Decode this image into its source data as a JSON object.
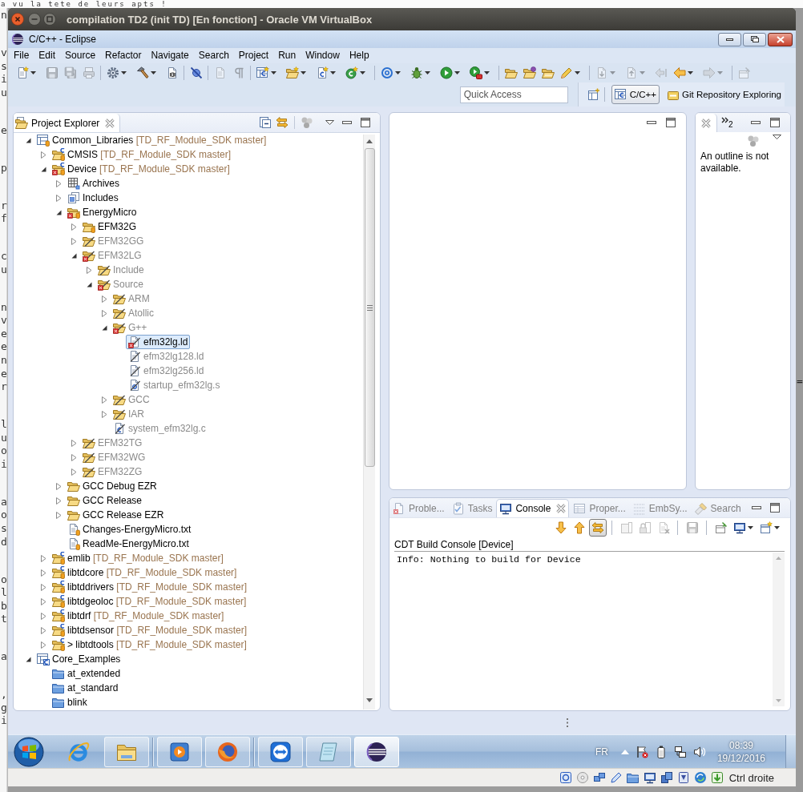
{
  "background": {
    "top_line": "a vu la tete de leurs apts !",
    "left_fragments": [
      "n",
      "v\ns\ni\nu",
      "e",
      "p",
      "r\nf",
      "c\nu",
      "n\nv\ne\ne\nn\ne\nr",
      "l\nu\no\ni",
      "a\no\ns\nd",
      "o\nl\nb\nt",
      "a",
      ",\ng\ni"
    ],
    "right_fragment": "="
  },
  "vm_window": {
    "title": "compilation TD2 (init TD) [En fonction] - Oracle VM VirtualBox",
    "status_bar": {
      "indicators": [
        {
          "kind": "harddisk"
        },
        {
          "kind": "optical"
        },
        {
          "kind": "network"
        },
        {
          "kind": "usb"
        },
        {
          "kind": "sharedfolder"
        },
        {
          "kind": "display"
        },
        {
          "kind": "capture"
        },
        {
          "kind": "vtx"
        },
        {
          "kind": "mouse"
        },
        {
          "kind": "keyboard"
        }
      ],
      "host_key": "Ctrl droite"
    }
  },
  "eclipse": {
    "title": "C/C++ - Eclipse",
    "menu": [
      "File",
      "Edit",
      "Source",
      "Refactor",
      "Navigate",
      "Search",
      "Project",
      "Run",
      "Window",
      "Help"
    ],
    "toolbar": {
      "groups": [
        {
          "items": [
            {
              "kind": "new",
              "disabled": false,
              "menu": true
            },
            {
              "kind": "save",
              "disabled": true,
              "menu": false
            },
            {
              "kind": "saveall",
              "disabled": true,
              "menu": false
            },
            {
              "kind": "print",
              "disabled": true,
              "menu": false
            }
          ]
        },
        {
          "items": [
            {
              "kind": "configs",
              "disabled": false,
              "menu": true
            },
            {
              "kind": "build",
              "disabled": false,
              "menu": true
            },
            {
              "kind": "binary",
              "disabled": false,
              "menu": false
            }
          ]
        },
        {
          "items": [
            {
              "kind": "skip",
              "disabled": false,
              "menu": false
            }
          ]
        },
        {
          "items": [
            {
              "kind": "marks",
              "disabled": true,
              "menu": false
            },
            {
              "kind": "whitespace",
              "disabled": true,
              "menu": false
            }
          ]
        },
        {
          "items": [
            {
              "kind": "newproject",
              "disabled": false,
              "menu": true
            },
            {
              "kind": "newfolder",
              "disabled": false,
              "menu": true
            },
            {
              "kind": "newfile",
              "disabled": false,
              "menu": true
            },
            {
              "kind": "newclass",
              "disabled": false,
              "menu": true
            }
          ]
        },
        {
          "items": [
            {
              "kind": "at",
              "disabled": false,
              "menu": true
            },
            {
              "kind": "debug",
              "disabled": false,
              "menu": true
            },
            {
              "kind": "run",
              "disabled": false,
              "menu": true
            },
            {
              "kind": "external",
              "disabled": false,
              "menu": true
            }
          ]
        },
        {
          "items": [
            {
              "kind": "open",
              "disabled": false,
              "menu": false
            },
            {
              "kind": "openball",
              "disabled": false,
              "menu": false
            },
            {
              "kind": "openfolder",
              "disabled": false,
              "menu": false
            },
            {
              "kind": "pencil",
              "disabled": false,
              "menu": true
            }
          ]
        },
        {
          "items": [
            {
              "kind": "nextannot",
              "disabled": true,
              "menu": true
            },
            {
              "kind": "prevannot",
              "disabled": true,
              "menu": true
            },
            {
              "kind": "lastedit",
              "disabled": true,
              "menu": false
            },
            {
              "kind": "back",
              "disabled": false,
              "menu": true
            },
            {
              "kind": "forward",
              "disabled": true,
              "menu": true
            }
          ]
        },
        {
          "items": [
            {
              "kind": "pin",
              "disabled": true,
              "menu": false
            }
          ]
        }
      ]
    },
    "quick_access": {
      "placeholder": "Quick Access"
    },
    "perspectives": [
      {
        "kind": "cpp",
        "label": "C/C++",
        "selected": true
      },
      {
        "kind": "git",
        "label": "Git Repository Exploring",
        "selected": false
      }
    ]
  },
  "project_explorer": {
    "tab": "Project Explorer",
    "tree": [
      {
        "kind": "workingset",
        "label": "Common_Libraries",
        "decoration": "[TD_RF_Module_SDK master]",
        "expanded": true,
        "selected": false,
        "excluded": false,
        "error": false,
        "tracked": true,
        "children": [
          {
            "kind": "cproject",
            "label": "CMSIS",
            "decoration": "[TD_RF_Module_SDK master]",
            "expanded": false,
            "selected": false,
            "excluded": false,
            "error": false,
            "tracked": true
          },
          {
            "kind": "cproject",
            "label": "Device",
            "decoration": "[TD_RF_Module_SDK master]",
            "expanded": true,
            "selected": false,
            "excluded": false,
            "error": true,
            "tracked": true,
            "children": [
              {
                "kind": "archives",
                "label": "Archives",
                "expanded": false,
                "selected": false,
                "excluded": false,
                "error": false,
                "tracked": false
              },
              {
                "kind": "includes",
                "label": "Includes",
                "expanded": false,
                "selected": false,
                "excluded": false,
                "error": false,
                "tracked": false
              },
              {
                "kind": "folder",
                "label": "EnergyMicro",
                "expanded": true,
                "selected": false,
                "excluded": false,
                "error": true,
                "tracked": true,
                "children": [
                  {
                    "kind": "folder",
                    "label": "EFM32G",
                    "expanded": false,
                    "selected": false,
                    "excluded": false,
                    "error": false,
                    "tracked": true
                  },
                  {
                    "kind": "folder",
                    "label": "EFM32GG",
                    "expanded": false,
                    "selected": false,
                    "excluded": true,
                    "error": false,
                    "tracked": false
                  },
                  {
                    "kind": "folder",
                    "label": "EFM32LG",
                    "expanded": true,
                    "selected": false,
                    "excluded": true,
                    "error": true,
                    "tracked": false,
                    "children": [
                      {
                        "kind": "folder",
                        "label": "Include",
                        "expanded": false,
                        "selected": false,
                        "excluded": true,
                        "error": false,
                        "tracked": false
                      },
                      {
                        "kind": "folder",
                        "label": "Source",
                        "expanded": true,
                        "selected": false,
                        "excluded": true,
                        "error": true,
                        "tracked": false,
                        "children": [
                          {
                            "kind": "folder",
                            "label": "ARM",
                            "expanded": false,
                            "selected": false,
                            "excluded": true,
                            "error": false,
                            "tracked": false
                          },
                          {
                            "kind": "folder",
                            "label": "Atollic",
                            "expanded": false,
                            "selected": false,
                            "excluded": true,
                            "error": false,
                            "tracked": false
                          },
                          {
                            "kind": "folder",
                            "label": "G++",
                            "expanded": true,
                            "selected": false,
                            "excluded": true,
                            "error": true,
                            "tracked": false,
                            "children": [
                              {
                                "kind": "file",
                                "label": "efm32lg.ld",
                                "selected": true,
                                "excluded": true,
                                "error": true,
                                "tracked": false
                              },
                              {
                                "kind": "file",
                                "label": "efm32lg128.ld",
                                "selected": false,
                                "excluded": true,
                                "error": false,
                                "tracked": false
                              },
                              {
                                "kind": "file",
                                "label": "efm32lg256.ld",
                                "selected": false,
                                "excluded": true,
                                "error": false,
                                "tracked": false
                              },
                              {
                                "kind": "asmfile",
                                "label": "startup_efm32lg.s",
                                "selected": false,
                                "excluded": true,
                                "error": false,
                                "tracked": false
                              }
                            ]
                          },
                          {
                            "kind": "folder",
                            "label": "GCC",
                            "expanded": false,
                            "selected": false,
                            "excluded": true,
                            "error": false,
                            "tracked": false
                          },
                          {
                            "kind": "folder",
                            "label": "IAR",
                            "expanded": false,
                            "selected": false,
                            "excluded": true,
                            "error": false,
                            "tracked": false
                          },
                          {
                            "kind": "cfile",
                            "label": "system_efm32lg.c",
                            "selected": false,
                            "excluded": true,
                            "error": false,
                            "tracked": false
                          }
                        ]
                      }
                    ]
                  },
                  {
                    "kind": "folder",
                    "label": "EFM32TG",
                    "expanded": false,
                    "selected": false,
                    "excluded": true,
                    "error": false,
                    "tracked": false
                  },
                  {
                    "kind": "folder",
                    "label": "EFM32WG",
                    "expanded": false,
                    "selected": false,
                    "excluded": true,
                    "error": false,
                    "tracked": false
                  },
                  {
                    "kind": "folder",
                    "label": "EFM32ZG",
                    "expanded": false,
                    "selected": false,
                    "excluded": true,
                    "error": false,
                    "tracked": false
                  }
                ]
              },
              {
                "kind": "folder",
                "label": "GCC Debug EZR",
                "expanded": false,
                "selected": false,
                "excluded": false,
                "error": false,
                "tracked": false
              },
              {
                "kind": "folder",
                "label": "GCC Release",
                "expanded": false,
                "selected": false,
                "excluded": false,
                "error": false,
                "tracked": false
              },
              {
                "kind": "folder",
                "label": "GCC Release EZR",
                "expanded": false,
                "selected": false,
                "excluded": false,
                "error": false,
                "tracked": false
              },
              {
                "kind": "textfile",
                "label": "Changes-EnergyMicro.txt",
                "selected": false,
                "excluded": false,
                "error": false,
                "tracked": true
              },
              {
                "kind": "textfile",
                "label": "ReadMe-EnergyMicro.txt",
                "selected": false,
                "excluded": false,
                "error": false,
                "tracked": true
              }
            ]
          },
          {
            "kind": "cproject",
            "label": "emlib",
            "decoration": "[TD_RF_Module_SDK master]",
            "expanded": false,
            "selected": false,
            "excluded": false,
            "error": false,
            "tracked": true
          },
          {
            "kind": "cproject",
            "label": "libtdcore",
            "decoration": "[TD_RF_Module_SDK master]",
            "expanded": false,
            "selected": false,
            "excluded": false,
            "error": false,
            "tracked": true
          },
          {
            "kind": "cproject",
            "label": "libtddrivers",
            "decoration": "[TD_RF_Module_SDK master]",
            "expanded": false,
            "selected": false,
            "excluded": false,
            "error": false,
            "tracked": true
          },
          {
            "kind": "cproject",
            "label": "libtdgeoloc",
            "decoration": "[TD_RF_Module_SDK master]",
            "expanded": false,
            "selected": false,
            "excluded": false,
            "error": false,
            "tracked": true
          },
          {
            "kind": "cproject",
            "label": "libtdrf",
            "decoration": "[TD_RF_Module_SDK master]",
            "expanded": false,
            "selected": false,
            "excluded": false,
            "error": false,
            "tracked": true
          },
          {
            "kind": "cproject",
            "label": "libtdsensor",
            "decoration": "[TD_RF_Module_SDK master]",
            "expanded": false,
            "selected": false,
            "excluded": false,
            "error": false,
            "tracked": true
          },
          {
            "kind": "cproject",
            "label": "> libtdtools",
            "decoration": "[TD_RF_Module_SDK master]",
            "expanded": false,
            "selected": false,
            "excluded": false,
            "error": false,
            "tracked": true
          }
        ]
      },
      {
        "kind": "cworkingset",
        "label": "Core_Examples",
        "expanded": true,
        "selected": false,
        "excluded": false,
        "error": false,
        "tracked": false,
        "children": [
          {
            "kind": "examplefolder",
            "label": "at_extended",
            "selected": false,
            "excluded": false,
            "error": false,
            "tracked": false
          },
          {
            "kind": "examplefolder",
            "label": "at_standard",
            "selected": false,
            "excluded": false,
            "error": false,
            "tracked": false
          },
          {
            "kind": "examplefolder",
            "label": "blink",
            "selected": false,
            "excluded": false,
            "error": false,
            "tracked": false
          }
        ]
      }
    ]
  },
  "outline": {
    "overflow_count": "2",
    "message": "An outline is not available."
  },
  "console": {
    "tabs": [
      {
        "kind": "problems",
        "label": "Proble...",
        "selected": false
      },
      {
        "kind": "tasks",
        "label": "Tasks",
        "selected": false
      },
      {
        "kind": "console",
        "label": "Console",
        "selected": true
      },
      {
        "kind": "properties",
        "label": "Proper...",
        "selected": false
      },
      {
        "kind": "registers",
        "label": "EmbSy...",
        "selected": false
      },
      {
        "kind": "search",
        "label": "Search",
        "selected": false
      }
    ],
    "toolbar": {
      "groups": [
        {
          "items": [
            {
              "kind": "down",
              "disabled": false,
              "pressed": false,
              "menu": false
            },
            {
              "kind": "up",
              "disabled": false,
              "pressed": false,
              "menu": false
            },
            {
              "kind": "scrolllock",
              "disabled": false,
              "pressed": true,
              "menu": false
            }
          ]
        },
        {
          "items": [
            {
              "kind": "showout",
              "disabled": true,
              "pressed": false,
              "menu": false
            },
            {
              "kind": "lock",
              "disabled": true,
              "pressed": false,
              "menu": false
            },
            {
              "kind": "remove",
              "disabled": true,
              "pressed": false,
              "menu": false
            }
          ]
        },
        {
          "items": [
            {
              "kind": "savelog",
              "disabled": true,
              "pressed": false,
              "menu": false
            }
          ]
        },
        {
          "items": [
            {
              "kind": "pinconsole",
              "disabled": false,
              "pressed": false,
              "menu": false
            },
            {
              "kind": "display",
              "disabled": false,
              "pressed": false,
              "menu": true
            },
            {
              "kind": "openconsole",
              "disabled": false,
              "pressed": false,
              "menu": true
            }
          ]
        }
      ]
    },
    "title": "CDT Build Console [Device]",
    "lines": [
      "Info: Nothing to build for Device"
    ]
  },
  "taskbar": {
    "groups": [
      {
        "apps": [
          {
            "kind": "ie",
            "running": false,
            "active": false
          },
          {
            "kind": "explorer",
            "running": true,
            "active": false
          }
        ]
      },
      {
        "apps": [
          {
            "kind": "media",
            "running": true,
            "active": false
          },
          {
            "kind": "firefox",
            "running": true,
            "active": false
          }
        ]
      },
      {
        "apps": [
          {
            "kind": "teamviewer",
            "running": true,
            "active": false
          },
          {
            "kind": "notepad",
            "running": true,
            "active": false
          },
          {
            "kind": "eclipse",
            "running": true,
            "active": true
          }
        ]
      }
    ],
    "language": "FR",
    "tray": [
      {
        "kind": "expand"
      },
      {
        "kind": "flag"
      },
      {
        "kind": "battery"
      },
      {
        "kind": "network"
      },
      {
        "kind": "volume"
      }
    ],
    "time": "08:39",
    "date": "19/12/2016"
  }
}
